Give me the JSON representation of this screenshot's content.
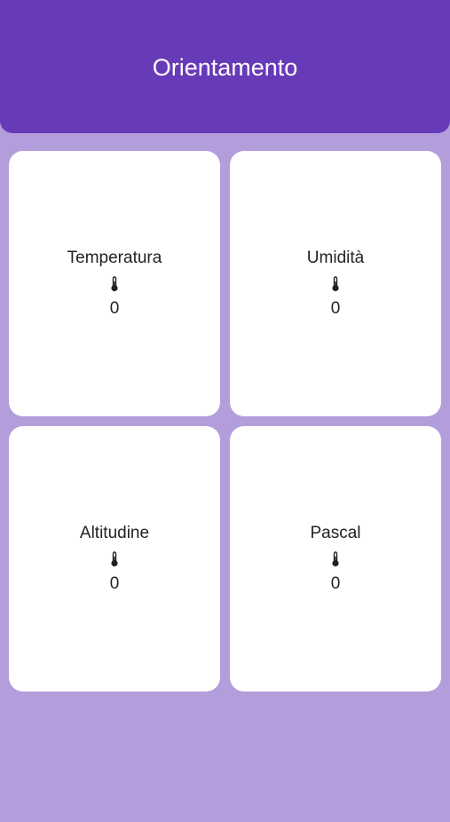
{
  "header": {
    "title": "Orientamento"
  },
  "colors": {
    "app_bar": "#673ab7",
    "background": "#b39ddb",
    "card": "#ffffff"
  },
  "cards": [
    {
      "label": "Temperatura",
      "icon": "thermometer-icon",
      "value": "0"
    },
    {
      "label": "Umidità",
      "icon": "thermometer-icon",
      "value": "0"
    },
    {
      "label": "Altitudine",
      "icon": "thermometer-icon",
      "value": "0"
    },
    {
      "label": "Pascal",
      "icon": "thermometer-icon",
      "value": "0"
    }
  ]
}
